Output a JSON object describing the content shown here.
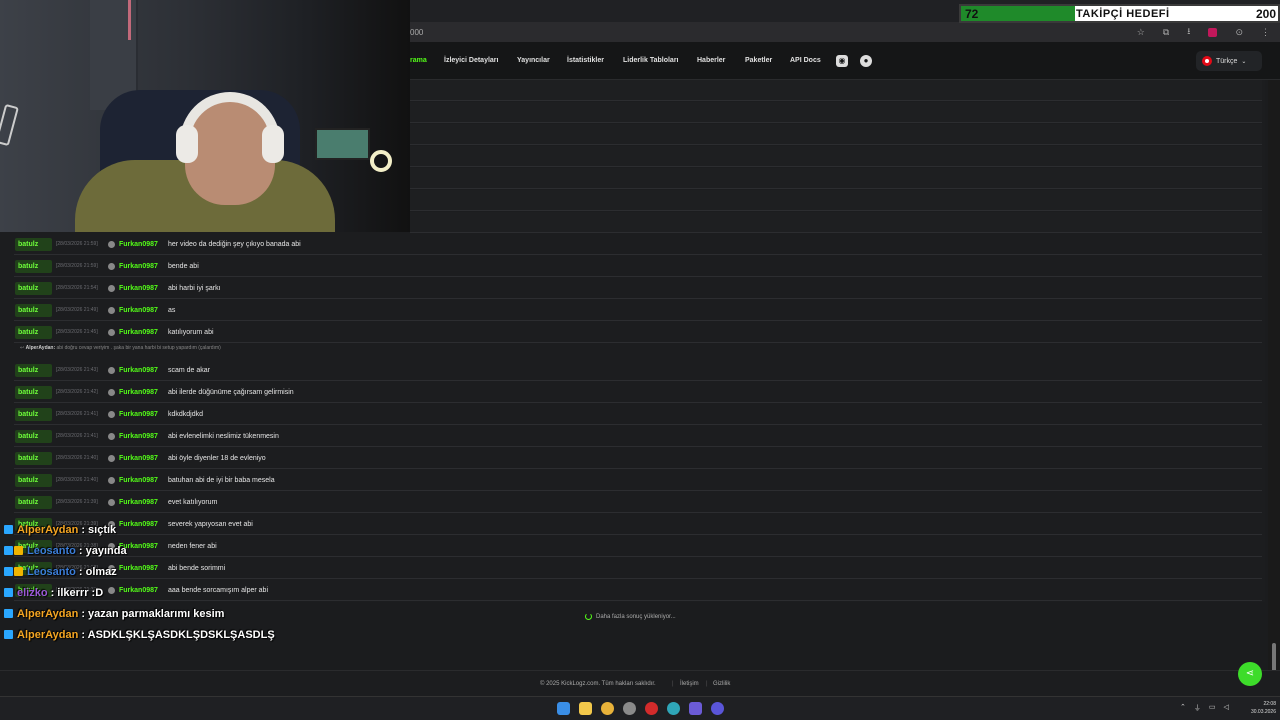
{
  "browser": {
    "url_fragment": "000",
    "ext_label": "R"
  },
  "goal": {
    "current": "72",
    "title": "TAKİPÇİ HEDEFİ",
    "target": "200",
    "progress": 0.36,
    "colors": {
      "fill": "#1f8a2a",
      "bg": "#ffffff"
    }
  },
  "nav": {
    "items": [
      "Arama",
      "İzleyici Detayları",
      "Yayıncılar",
      "İstatistikler",
      "Liderlik Tabloları",
      "Haberler",
      "Paketler",
      "API Docs"
    ],
    "active_visible": "rama",
    "icons": [
      "discord-icon",
      "user-icon"
    ],
    "language": "Türkçe"
  },
  "log": {
    "rows": [
      {
        "channel": "batulz",
        "time": "[28/03/2026 21:59]",
        "user": "Furkan0987",
        "message": "her video da dediğin şey çıkıyo banada abi"
      },
      {
        "channel": "batulz",
        "time": "[28/03/2026 21:59]",
        "user": "Furkan0987",
        "message": "bende abi"
      },
      {
        "channel": "batulz",
        "time": "[28/03/2026 21:54]",
        "user": "Furkan0987",
        "message": "abi harbi iyi şarkı"
      },
      {
        "channel": "batulz",
        "time": "[28/03/2026 21:49]",
        "user": "Furkan0987",
        "message": "as"
      },
      {
        "channel": "batulz",
        "time": "[28/03/2026 21:45]",
        "user": "Furkan0987",
        "message": "katılıyorum abi"
      },
      {
        "channel": "batulz",
        "time": "[28/03/2026 21:43]",
        "user": "Furkan0987",
        "message": "scam de akar"
      },
      {
        "channel": "batulz",
        "time": "[28/03/2026 21:42]",
        "user": "Furkan0987",
        "message": "abi ilerde düğünüme çağırsam gelirmisin"
      },
      {
        "channel": "batulz",
        "time": "[28/03/2026 21:41]",
        "user": "Furkan0987",
        "message": "kdkdkdjdkd"
      },
      {
        "channel": "batulz",
        "time": "[28/03/2026 21:41]",
        "user": "Furkan0987",
        "message": "abi evlenelimki neslimiz tükenmesin"
      },
      {
        "channel": "batulz",
        "time": "[28/03/2026 21:40]",
        "user": "Furkan0987",
        "message": "abi öyle diyenler 18 de evleniyo"
      },
      {
        "channel": "batulz",
        "time": "[28/03/2026 21:40]",
        "user": "Furkan0987",
        "message": "batuhan abi de iyi bir baba mesela"
      },
      {
        "channel": "batulz",
        "time": "[28/03/2026 21:39]",
        "user": "Furkan0987",
        "message": "evet katılıyorum"
      },
      {
        "channel": "batulz",
        "time": "[28/03/2026 21:39]",
        "user": "Furkan0987",
        "message": "severek yapıyosan evet abi"
      },
      {
        "channel": "batulz",
        "time": "[28/03/2026 21:38]",
        "user": "Furkan0987",
        "message": "neden fener abi"
      },
      {
        "channel": "batulz",
        "time": "[28/03/2026 21:38]",
        "user": "Furkan0987",
        "message": "abi bende sorimmi"
      },
      {
        "channel": "batulz",
        "time": "[28/03/2026 21:37]",
        "user": "Furkan0987",
        "message": "aaa bende sorcamışım alper abi"
      }
    ],
    "reply": {
      "user": "AlperAydan:",
      "text": "abi doğru cevap veriyim . şaka bir yana harbi bi setup yapardım (çalardım)"
    },
    "loading": "Daha fazla sonuç yükleniyor..."
  },
  "footer": {
    "copyright": "© 2025 KickLogz.com. Tüm hakları saklıdır.",
    "contact": "İletişim",
    "privacy": "Gizlilik",
    "sep": "|"
  },
  "stream_chat": [
    {
      "user": "AlperAydan",
      "message": ": sıçtık",
      "color": "#f5a623",
      "badges": [
        "kick"
      ]
    },
    {
      "user": "Leosanto",
      "message": ": yayında",
      "color": "#3b7dd8",
      "badges": [
        "kick",
        "sub"
      ]
    },
    {
      "user": "Leosanto",
      "message": ": olmaz",
      "color": "#3b7dd8",
      "badges": [
        "kick",
        "sub"
      ]
    },
    {
      "user": "elizko",
      "message": ": ilkerrr :D",
      "color": "#9b59d6",
      "badges": [
        "kick"
      ]
    },
    {
      "user": "AlperAydan",
      "message": ": yazan parmaklarımı kesim",
      "color": "#f5a623",
      "badges": [
        "kick"
      ]
    },
    {
      "user": "AlperAydan",
      "message": ": ASDKLŞKLŞASDKLŞDSKLŞASDLŞ",
      "color": "#f5a623",
      "badges": [
        "kick"
      ]
    }
  ],
  "taskbar": {
    "time": "22:08",
    "date": "30.03.2026"
  }
}
